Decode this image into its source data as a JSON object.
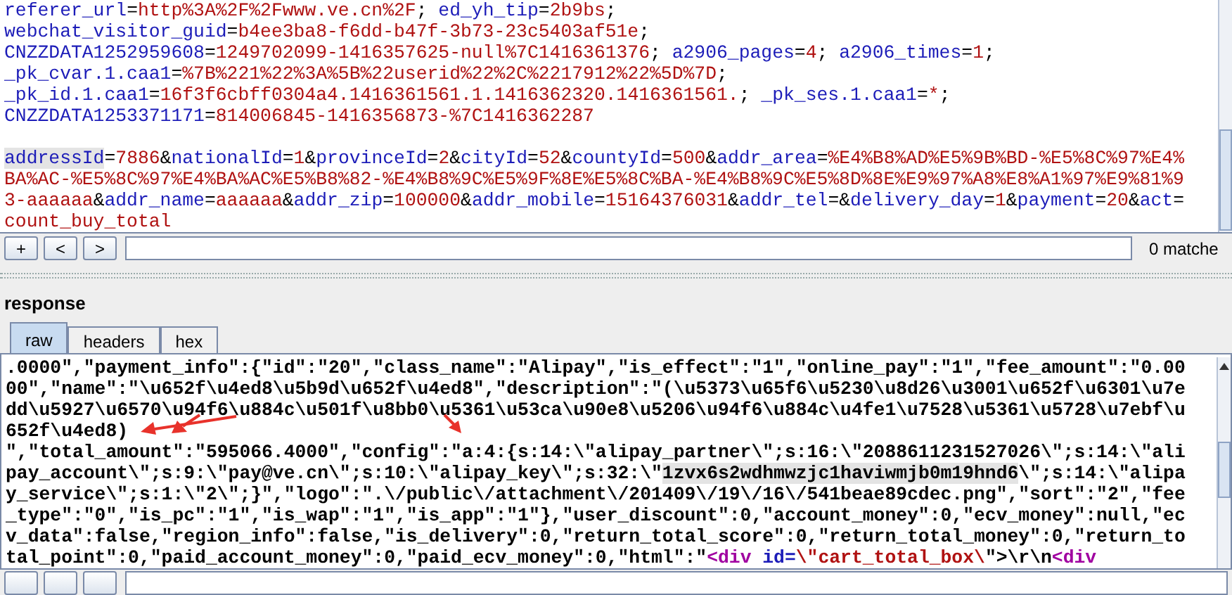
{
  "request": {
    "cookie_lines": [
      [
        {
          "kind": "key",
          "text": "referer_url"
        },
        {
          "kind": "punct",
          "text": "="
        },
        {
          "kind": "value",
          "text": "http%3A%2F%2Fwww.ve.cn%2F"
        },
        {
          "kind": "punct",
          "text": "; "
        },
        {
          "kind": "key",
          "text": "ed_yh_tip"
        },
        {
          "kind": "punct",
          "text": "="
        },
        {
          "kind": "value",
          "text": "2b9bs"
        },
        {
          "kind": "punct",
          "text": ";"
        }
      ],
      [
        {
          "kind": "key",
          "text": "webchat_visitor_guid"
        },
        {
          "kind": "punct",
          "text": "="
        },
        {
          "kind": "value",
          "text": "b4ee3ba8-f6dd-b47f-3b73-23c5403af51e"
        },
        {
          "kind": "punct",
          "text": ";"
        }
      ],
      [
        {
          "kind": "key",
          "text": "CNZZDATA1252959608"
        },
        {
          "kind": "punct",
          "text": "="
        },
        {
          "kind": "value",
          "text": "1249702099-1416357625-null%7C1416361376"
        },
        {
          "kind": "punct",
          "text": "; "
        },
        {
          "kind": "key",
          "text": "a2906_pages"
        },
        {
          "kind": "punct",
          "text": "="
        },
        {
          "kind": "value",
          "text": "4"
        },
        {
          "kind": "punct",
          "text": "; "
        },
        {
          "kind": "key",
          "text": "a2906_times"
        },
        {
          "kind": "punct",
          "text": "="
        },
        {
          "kind": "value",
          "text": "1"
        },
        {
          "kind": "punct",
          "text": ";"
        }
      ],
      [
        {
          "kind": "key",
          "text": "_pk_cvar.1.caa1"
        },
        {
          "kind": "punct",
          "text": "="
        },
        {
          "kind": "value",
          "text": "%7B%221%22%3A%5B%22userid%22%2C%2217912%22%5D%7D"
        },
        {
          "kind": "punct",
          "text": ";"
        }
      ],
      [
        {
          "kind": "key",
          "text": "_pk_id.1.caa1"
        },
        {
          "kind": "punct",
          "text": "="
        },
        {
          "kind": "value",
          "text": "16f3f6cbff0304a4.1416361561.1.1416362320.1416361561."
        },
        {
          "kind": "punct",
          "text": "; "
        },
        {
          "kind": "key",
          "text": "_pk_ses.1.caa1"
        },
        {
          "kind": "punct",
          "text": "="
        },
        {
          "kind": "value",
          "text": "*"
        },
        {
          "kind": "punct",
          "text": ";"
        }
      ],
      [
        {
          "kind": "key",
          "text": "CNZZDATA1253371171"
        },
        {
          "kind": "punct",
          "text": "="
        },
        {
          "kind": "value",
          "text": "814006845-1416356873-%7C1416362287"
        }
      ]
    ],
    "body_lines": [
      [
        {
          "kind": "match_key",
          "text": "addressId"
        },
        {
          "kind": "punct",
          "text": "="
        },
        {
          "kind": "value",
          "text": "7886"
        },
        {
          "kind": "punct",
          "text": "&"
        },
        {
          "kind": "key",
          "text": "nationalId"
        },
        {
          "kind": "punct",
          "text": "="
        },
        {
          "kind": "value",
          "text": "1"
        },
        {
          "kind": "punct",
          "text": "&"
        },
        {
          "kind": "key",
          "text": "provinceId"
        },
        {
          "kind": "punct",
          "text": "="
        },
        {
          "kind": "value",
          "text": "2"
        },
        {
          "kind": "punct",
          "text": "&"
        },
        {
          "kind": "key",
          "text": "cityId"
        },
        {
          "kind": "punct",
          "text": "="
        },
        {
          "kind": "value",
          "text": "52"
        },
        {
          "kind": "punct",
          "text": "&"
        },
        {
          "kind": "key",
          "text": "countyId"
        },
        {
          "kind": "punct",
          "text": "="
        },
        {
          "kind": "value",
          "text": "500"
        },
        {
          "kind": "punct",
          "text": "&"
        },
        {
          "kind": "key",
          "text": "addr_area"
        },
        {
          "kind": "punct",
          "text": "="
        },
        {
          "kind": "value",
          "text": "%E4%B8%AD%E5%9B%BD-%E5%8C%97%E4%"
        }
      ],
      [
        {
          "kind": "value",
          "text": "BA%AC-%E5%8C%97%E4%BA%AC%E5%B8%82-%E4%B8%9C%E5%9F%8E%E5%8C%BA-%E4%B8%9C%E5%8D%8E%E9%97%A8%E8%A1%97%E9%81%9"
        }
      ],
      [
        {
          "kind": "value",
          "text": "3-aaaaaa"
        },
        {
          "kind": "punct",
          "text": "&"
        },
        {
          "kind": "key",
          "text": "addr_name"
        },
        {
          "kind": "punct",
          "text": "="
        },
        {
          "kind": "value",
          "text": "aaaaaa"
        },
        {
          "kind": "punct",
          "text": "&"
        },
        {
          "kind": "key",
          "text": "addr_zip"
        },
        {
          "kind": "punct",
          "text": "="
        },
        {
          "kind": "value",
          "text": "100000"
        },
        {
          "kind": "punct",
          "text": "&"
        },
        {
          "kind": "key",
          "text": "addr_mobile"
        },
        {
          "kind": "punct",
          "text": "="
        },
        {
          "kind": "value",
          "text": "15164376031"
        },
        {
          "kind": "punct",
          "text": "&"
        },
        {
          "kind": "key",
          "text": "addr_tel"
        },
        {
          "kind": "punct",
          "text": "=&"
        },
        {
          "kind": "key",
          "text": "delivery_day"
        },
        {
          "kind": "punct",
          "text": "="
        },
        {
          "kind": "value",
          "text": "1"
        },
        {
          "kind": "punct",
          "text": "&"
        },
        {
          "kind": "key",
          "text": "payment"
        },
        {
          "kind": "punct",
          "text": "="
        },
        {
          "kind": "value",
          "text": "20"
        },
        {
          "kind": "punct",
          "text": "&"
        },
        {
          "kind": "key",
          "text": "act"
        },
        {
          "kind": "punct",
          "text": "="
        }
      ],
      [
        {
          "kind": "value",
          "text": "count_buy_total"
        }
      ]
    ]
  },
  "request_search": {
    "buttons": [
      "+",
      "<",
      ">"
    ],
    "match_count": "0 matche"
  },
  "response": {
    "title": "response",
    "tabs": [
      {
        "label": "raw",
        "selected": true
      },
      {
        "label": "headers",
        "selected": false
      },
      {
        "label": "hex",
        "selected": false
      }
    ],
    "lines": [
      [
        {
          "kind": "text",
          "text": ".0000\",\"payment_info\":{\"id\":\"20\",\"class_name\":\"Alipay\",\"is_effect\":\"1\",\"online_pay\":\"1\",\"fee_amount\":\"0.00"
        }
      ],
      [
        {
          "kind": "text",
          "text": "00\",\"name\":\"\\u652f\\u4ed8\\u5b9d\\u652f\\u4ed8\",\"description\":\"(\\u5373\\u65f6\\u5230\\u8d26\\u3001\\u652f\\u6301\\u7e"
        }
      ],
      [
        {
          "kind": "text",
          "text": "dd\\u5927\\u6570\\u94f6\\u884c\\u501f\\u8bb0\\u5361\\u53ca\\u90e8\\u5206\\u94f6\\u884c\\u4fe1\\u7528\\u5361\\u5728\\u7ebf\\u"
        }
      ],
      [
        {
          "kind": "text",
          "text": "652f\\u4ed8)"
        }
      ],
      [
        {
          "kind": "text",
          "text": "\",\"total_amount\":\"595066.4000\",\"config\":\"a:4:{s:14:\\\"alipay_partner\\\";s:16:\\\"2088611231527026\\\";s:14:\\\"ali"
        }
      ],
      [
        {
          "kind": "text",
          "text": "pay_account\\\";s:9:\\\"pay@ve.cn\\\";s:10:\\\"alipay_key\\\";s:32:\\\""
        },
        {
          "kind": "match",
          "text": "1zvx6s2wdhmwzjc1haviwmjb0m19hnd6"
        },
        {
          "kind": "text",
          "text": "\\\";s:14:\\\"alipa"
        }
      ],
      [
        {
          "kind": "text",
          "text": "y_service\\\";s:1:\\\"2\\\";}\",\"logo\":\".\\/public\\/attachment\\/201409\\/19\\/16\\/541beae89cdec.png\",\"sort\":\"2\",\"fee"
        }
      ],
      [
        {
          "kind": "text",
          "text": "_type\":\"0\",\"is_pc\":\"1\",\"is_wap\":\"1\",\"is_app\":\"1\"},\"user_discount\":0,\"account_money\":0,\"ecv_money\":null,\"ec"
        }
      ],
      [
        {
          "kind": "text",
          "text": "v_data\":false,\"region_info\":false,\"is_delivery\":0,\"return_total_score\":0,\"return_total_money\":0,\"return_to"
        }
      ],
      [
        {
          "kind": "text",
          "text": "tal_point\":0,\"paid_account_money\":0,\"paid_ecv_money\":0,\"html\":\""
        },
        {
          "kind": "tag",
          "text": "<div"
        },
        {
          "kind": "attr",
          "text": " id="
        },
        {
          "kind": "value",
          "text": "\\\"cart_total_box\\"
        },
        {
          "kind": "text",
          "text": "\">\\r\\n"
        },
        {
          "kind": "tag",
          "text": "<div"
        }
      ]
    ]
  }
}
